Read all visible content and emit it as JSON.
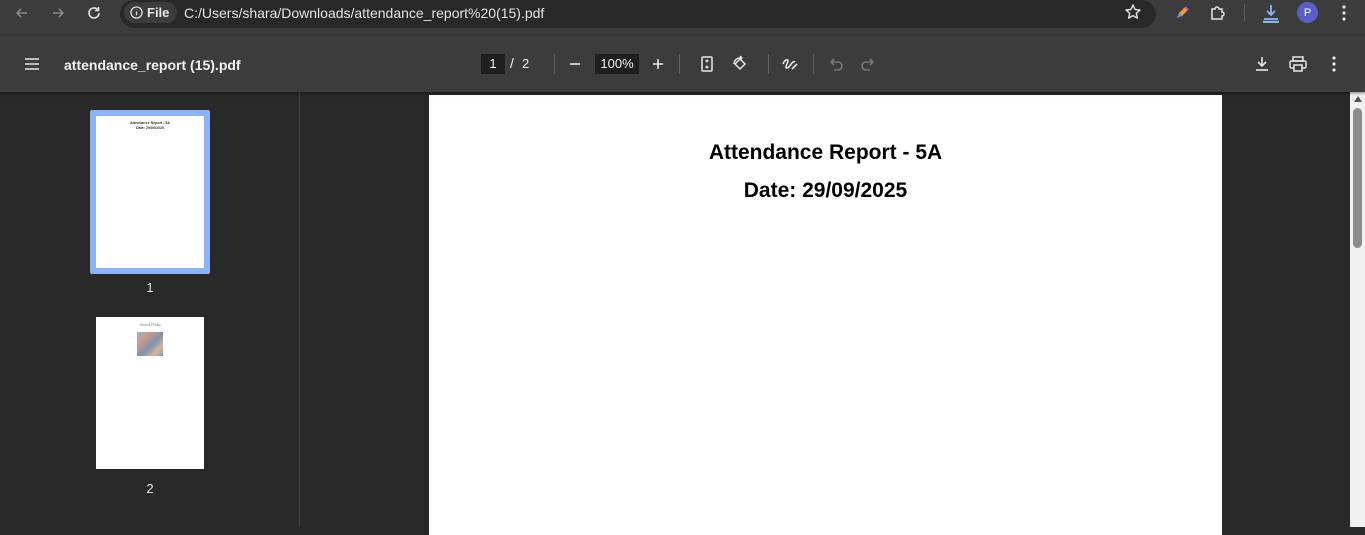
{
  "browser": {
    "file_chip": "File",
    "url": "C:/Users/shara/Downloads/attendance_report%20(15).pdf",
    "avatar_initial": "P"
  },
  "toolbar": {
    "title": "attendance_report (15).pdf",
    "current_page": "1",
    "page_separator": "/",
    "total_pages": "2",
    "zoom": "100%"
  },
  "sidebar": {
    "thumbnails": [
      {
        "label": "1",
        "line1": "Attendance Report - 5A",
        "line2": "Date: 29/09/2025"
      },
      {
        "label": "2",
        "line1": "Stored Photo"
      }
    ]
  },
  "document": {
    "title": "Attendance Report - 5A",
    "date": "Date: 29/09/2025"
  },
  "colors": {
    "accent": "#8ab4f8",
    "avatar": "#5b5ec7",
    "toolbar_bg": "#3c3c3c",
    "viewer_bg": "#282828"
  }
}
